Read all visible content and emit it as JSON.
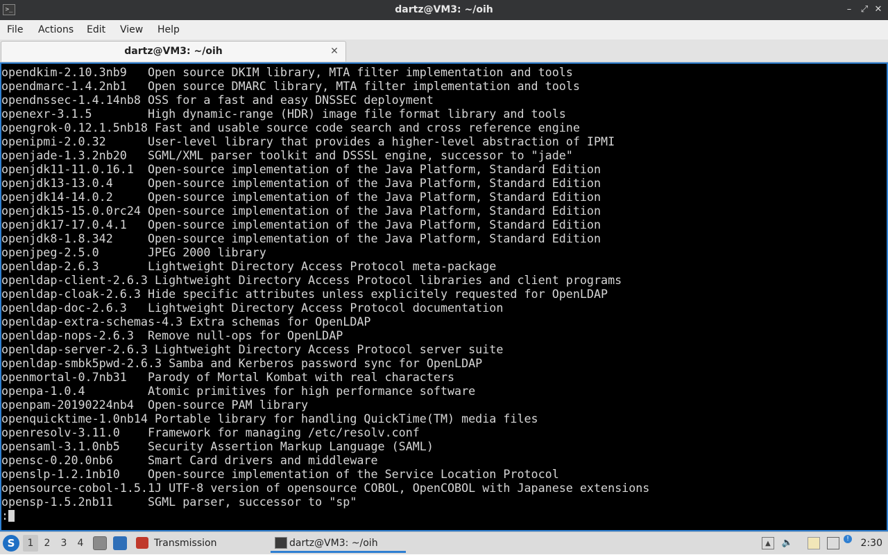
{
  "window": {
    "title": "dartz@VM3: ~/oih",
    "app_icon": "terminal-icon",
    "controls": {
      "minimize": "–",
      "restore": "⤢",
      "close": "✕"
    }
  },
  "menubar": {
    "items": [
      "File",
      "Actions",
      "Edit",
      "View",
      "Help"
    ]
  },
  "tab": {
    "label": "dartz@VM3: ~/oih",
    "close": "✕"
  },
  "terminal": {
    "lines": [
      "opendkim-2.10.3nb9   Open source DKIM library, MTA filter implementation and tools",
      "opendmarc-1.4.2nb1   Open source DMARC library, MTA filter implementation and tools",
      "opendnssec-1.4.14nb8 OSS for a fast and easy DNSSEC deployment",
      "openexr-3.1.5        High dynamic-range (HDR) image file format library and tools",
      "opengrok-0.12.1.5nb18 Fast and usable source code search and cross reference engine",
      "openipmi-2.0.32      User-level library that provides a higher-level abstraction of IPMI",
      "openjade-1.3.2nb20   SGML/XML parser toolkit and DSSSL engine, successor to \"jade\"",
      "openjdk11-11.0.16.1  Open-source implementation of the Java Platform, Standard Edition",
      "openjdk13-13.0.4     Open-source implementation of the Java Platform, Standard Edition",
      "openjdk14-14.0.2     Open-source implementation of the Java Platform, Standard Edition",
      "openjdk15-15.0.0rc24 Open-source implementation of the Java Platform, Standard Edition",
      "openjdk17-17.0.4.1   Open-source implementation of the Java Platform, Standard Edition",
      "openjdk8-1.8.342     Open-source implementation of the Java Platform, Standard Edition",
      "openjpeg-2.5.0       JPEG 2000 library",
      "openldap-2.6.3       Lightweight Directory Access Protocol meta-package",
      "openldap-client-2.6.3 Lightweight Directory Access Protocol libraries and client programs",
      "openldap-cloak-2.6.3 Hide specific attributes unless explicitely requested for OpenLDAP",
      "openldap-doc-2.6.3   Lightweight Directory Access Protocol documentation",
      "openldap-extra-schemas-4.3 Extra schemas for OpenLDAP",
      "openldap-nops-2.6.3  Remove null-ops for OpenLDAP",
      "openldap-server-2.6.3 Lightweight Directory Access Protocol server suite",
      "openldap-smbk5pwd-2.6.3 Samba and Kerberos password sync for OpenLDAP",
      "openmortal-0.7nb31   Parody of Mortal Kombat with real characters",
      "openpa-1.0.4         Atomic primitives for high performance software",
      "openpam-20190224nb4  Open-source PAM library",
      "openquicktime-1.0nb14 Portable library for handling QuickTime(TM) media files",
      "openresolv-3.11.0    Framework for managing /etc/resolv.conf",
      "opensaml-3.1.0nb5    Security Assertion Markup Language (SAML)",
      "opensc-0.20.0nb6     Smart Card drivers and middleware",
      "openslp-1.2.1nb10    Open-source implementation of the Service Location Protocol",
      "opensource-cobol-1.5.1J UTF-8 version of opensource COBOL, OpenCOBOL with Japanese extensions",
      "opensp-1.5.2nb11     SGML parser, successor to \"sp\""
    ],
    "prompt": ":"
  },
  "taskbar": {
    "start_icon": "start-menu-icon",
    "workspaces": [
      "1",
      "2",
      "3",
      "4"
    ],
    "active_workspace": "1",
    "tasks": [
      {
        "label": "Transmission",
        "icon": "transmission-icon"
      },
      {
        "label": "dartz@VM3: ~/oih",
        "icon": "terminal-icon"
      }
    ],
    "clock": "2:30"
  },
  "colors": {
    "accent": "#2f7fd1",
    "terminal_bg": "#000000",
    "terminal_fg": "#d6d6d6"
  }
}
